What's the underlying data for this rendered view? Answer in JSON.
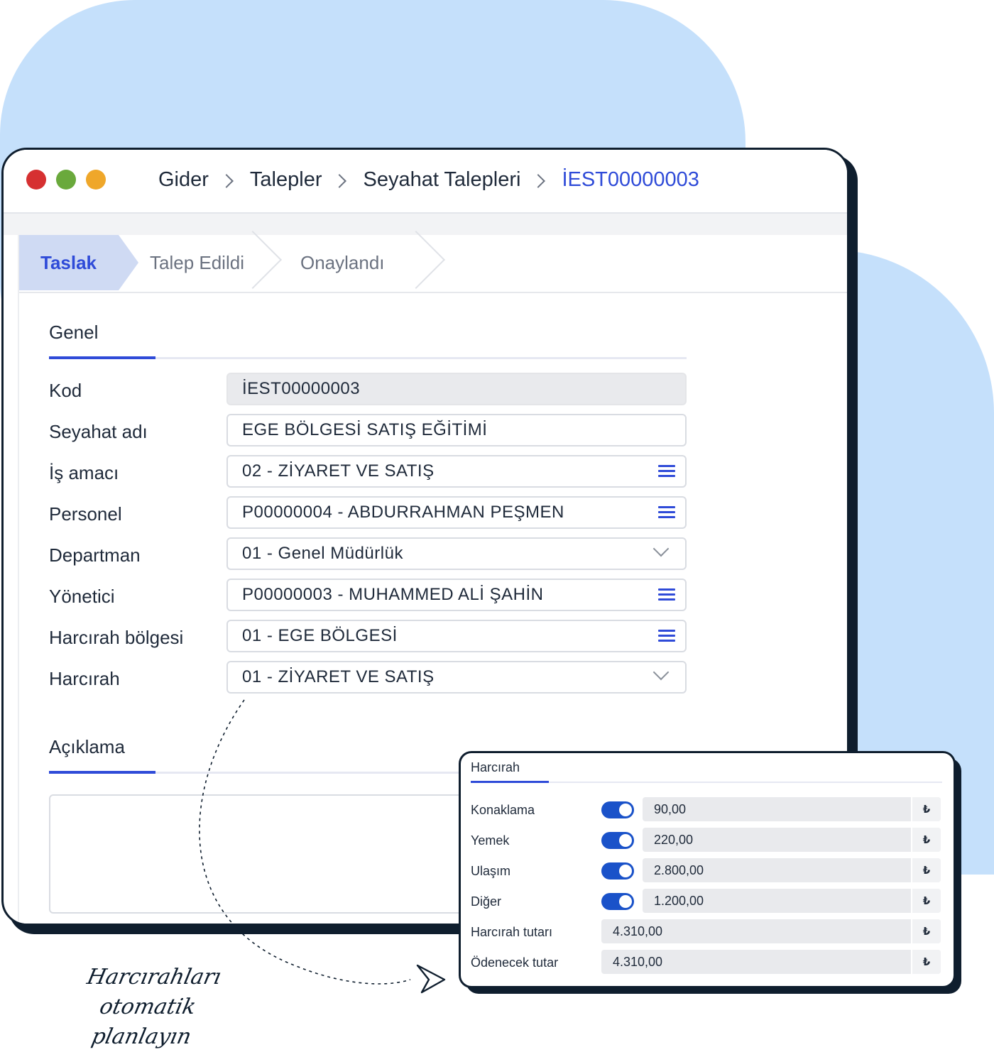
{
  "breadcrumb": {
    "items": [
      "Gider",
      "Talepler",
      "Seyahat Talepleri"
    ],
    "current": "İEST00000003"
  },
  "steps": [
    "Taslak",
    "Talep Edildi",
    "Onaylandı"
  ],
  "sections": {
    "genel": "Genel",
    "aciklama": "Açıklama"
  },
  "form": {
    "kod": {
      "label": "Kod",
      "value": "İEST00000003"
    },
    "seyahat_adi": {
      "label": "Seyahat adı",
      "value": "EGE BÖLGESİ SATIŞ EĞİTİMİ"
    },
    "is_amaci": {
      "label": "İş amacı",
      "value": "02 - ZİYARET VE SATIŞ"
    },
    "personel": {
      "label": "Personel",
      "value": "P00000004 - ABDURRAHMAN PEŞMEN"
    },
    "departman": {
      "label": "Departman",
      "value": "01 - Genel Müdürlük"
    },
    "yonetici": {
      "label": "Yönetici",
      "value": "P00000003 - MUHAMMED ALİ ŞAHİN"
    },
    "harcirah_bolgesi": {
      "label": "Harcırah bölgesi",
      "value": "01 - EGE BÖLGESİ"
    },
    "harcirah": {
      "label": "Harcırah",
      "value": "01 - ZİYARET VE SATIŞ"
    }
  },
  "popup": {
    "title": "Harcırah",
    "currency": "₺",
    "rows": [
      {
        "label": "Konaklama",
        "value": "90,00",
        "toggle": true
      },
      {
        "label": "Yemek",
        "value": "220,00",
        "toggle": true
      },
      {
        "label": "Ulaşım",
        "value": "2.800,00",
        "toggle": true
      },
      {
        "label": "Diğer",
        "value": "1.200,00",
        "toggle": true
      }
    ],
    "harcirah_tutari": {
      "label": "Harcırah tutarı",
      "value": "4.310,00"
    },
    "odenecek_tutar": {
      "label": "Ödenecek tutar",
      "value": "4.310,00"
    }
  },
  "tagline": {
    "line1": "Harcırahları otomatik",
    "line2": "planlayın"
  },
  "colors": {
    "accent": "#2f4bd8",
    "toggle": "#1a52c9",
    "background_blob": "#c5e0fb",
    "frame": "#0f1e2e"
  }
}
